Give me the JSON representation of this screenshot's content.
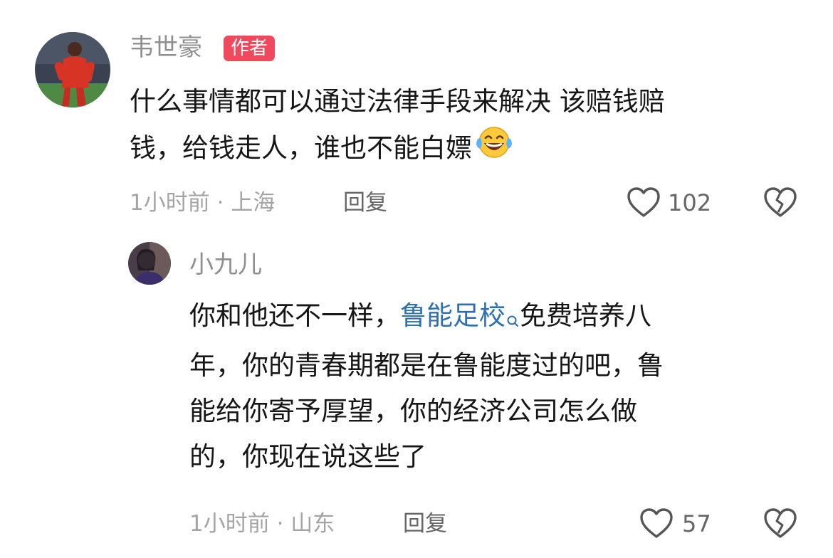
{
  "comment": {
    "author": "韦世豪",
    "badge": "作者",
    "lines": [
      "什么事情都可以通过法律手段来解决 该赔钱赔",
      "钱，给钱走人，谁也不能白嫖"
    ],
    "emoji": "laughing-crying",
    "time": "1小时前",
    "sep": " · ",
    "location": "上海",
    "reply_label": "回复",
    "likes": "102"
  },
  "reply": {
    "author": "小九儿",
    "line1_pre": "你和他还不一样，",
    "line1_link": "鲁能足校",
    "line1_post": "免费培养八",
    "lines": [
      "年，你的青春期都是在鲁能度过的吧，鲁",
      "能给你寄予厚望，你的经济公司怎么做",
      "的，你现在说这些了"
    ],
    "time": "1小时前",
    "sep": " · ",
    "location": "山东",
    "reply_label": "回复",
    "likes": "57"
  },
  "colors": {
    "badge": "#f0485c",
    "link": "#2f6fb3",
    "meta": "#a4a4a4",
    "name": "#8f8f8f"
  }
}
